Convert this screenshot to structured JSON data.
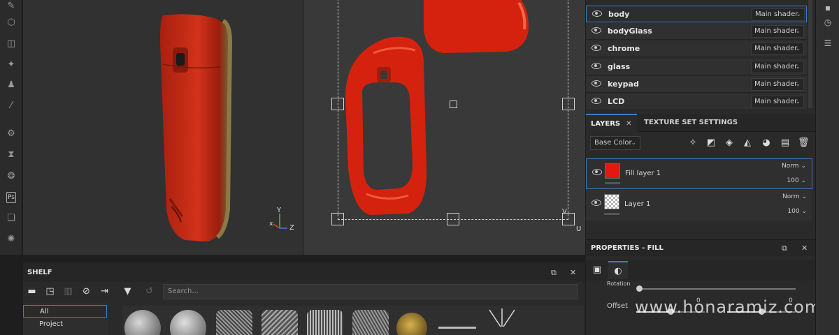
{
  "left_toolbar": {
    "icons": [
      "brush-icon",
      "cube-icon",
      "eraser-icon",
      "pin-icon",
      "stamp-icon",
      "pipette-icon",
      "gear-icon",
      "hourglass-icon",
      "cog-icon",
      "photoshop-icon",
      "export-icon",
      "settings-icon"
    ],
    "ps_label": "Ps"
  },
  "viewport3d": {
    "axis_y": "Y",
    "axis_z": "Z"
  },
  "viewport2d": {
    "axis_v": "V",
    "axis_u": "U"
  },
  "texture_sets": [
    {
      "name": "body",
      "shader": "Main shader",
      "selected": true
    },
    {
      "name": "bodyGlass",
      "shader": "Main shader",
      "selected": false
    },
    {
      "name": "chrome",
      "shader": "Main shader",
      "selected": false
    },
    {
      "name": "glass",
      "shader": "Main shader",
      "selected": false
    },
    {
      "name": "keypad",
      "shader": "Main shader",
      "selected": false
    },
    {
      "name": "LCD",
      "shader": "Main shader",
      "selected": false
    }
  ],
  "layers_panel": {
    "tab_layers": "LAYERS",
    "tab_close": "✕",
    "tab_texture_set_settings": "TEXTURE SET SETTINGS",
    "channel": "Base Color",
    "layers": [
      {
        "name": "Fill layer 1",
        "blend": "Norm",
        "opacity": "100",
        "thumb": "red"
      },
      {
        "name": "Layer 1",
        "blend": "Norm",
        "opacity": "100",
        "thumb": "checker"
      }
    ]
  },
  "properties": {
    "title": "PROPERTIES - FILL",
    "rotation_label": "Rotation",
    "offset_label": "Offset",
    "offset_x": "0",
    "offset_y": "0",
    "watermark": "www.honaramiz.com"
  },
  "shelf": {
    "title": "SHELF",
    "search_placeholder": "Search...",
    "categories": [
      "All",
      "Project"
    ]
  },
  "colors": {
    "accent": "#3d7cc4",
    "fill_red": "#e4180f"
  }
}
